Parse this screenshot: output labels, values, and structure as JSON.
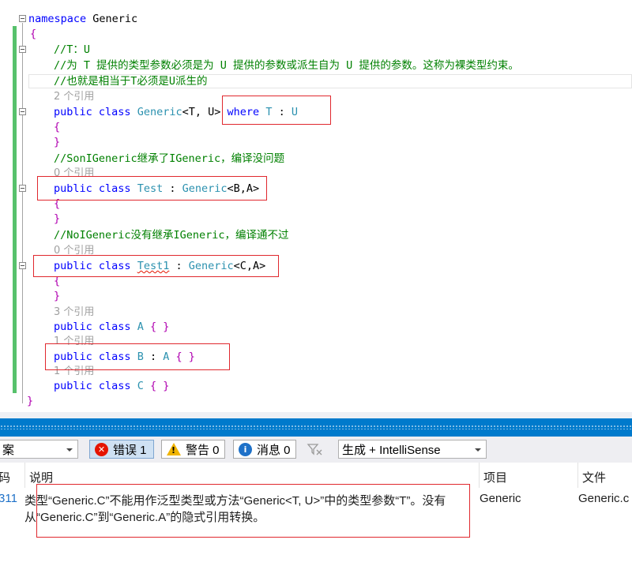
{
  "editor": {
    "line1": {
      "kw": "namespace",
      "name": " Generic"
    },
    "open_brace": "{",
    "close_brace": "}",
    "comment1": "//T：U",
    "comment2": "//为 T 提供的类型参数必须是为 U 提供的参数或派生自为 U 提供的参数。这称为裸类型约束。",
    "comment3": "//也就是相当于T必须是U派生的",
    "ref_generic": "2 个引用",
    "generic_decl": {
      "p1": "public",
      "p2": "class",
      "name": "Generic",
      "params": "<T, U>",
      "where": "where",
      "T": "T",
      "colon": " : ",
      "U": "U"
    },
    "comment4": "//SonIGeneric继承了IGeneric，编译没问题",
    "ref_test": "0 个引用",
    "test_decl": {
      "p1": "public",
      "p2": "class",
      "name": "Test",
      "colon": " : ",
      "base": "Generic",
      "args": "<B,A>"
    },
    "comment5": "//NoIGeneric没有继承IGeneric，编译通不过",
    "ref_test1": "0 个引用",
    "test1_decl": {
      "p1": "public",
      "p2": "class",
      "name": "Test1",
      "colon": " : ",
      "base": "Generic",
      "args": "<C,A>"
    },
    "ref_a": "3 个引用",
    "a_decl": {
      "p1": "public",
      "p2": "class",
      "name": "A",
      "body": "{ }"
    },
    "ref_b": "1 个引用",
    "b_decl": {
      "p1": "public",
      "p2": "class",
      "name": "B",
      "colon": " : ",
      "base": "A",
      "body": "{ }"
    },
    "ref_c": "1 个引用",
    "c_decl": {
      "p1": "public",
      "p2": "class",
      "name": "C",
      "body": "{ }"
    }
  },
  "error_list": {
    "scope_dropdown": "案",
    "errors_label": "错误 1",
    "warnings_label": "警告 0",
    "messages_label": "消息 0",
    "build_dropdown": "生成 + IntelliSense",
    "columns": {
      "code": "码",
      "description": "说明",
      "project": "项目",
      "file": "文件"
    },
    "rows": [
      {
        "code": "311",
        "description_line1": "类型“Generic.C”不能用作泛型类型或方法“Generic<T, U>”中的类型参数“T”。没有",
        "description_line2": "从“Generic.C”到“Generic.A”的隐式引用转换。",
        "project": "Generic",
        "file": "Generic.c"
      }
    ]
  },
  "colors": {
    "keyword": "#0000ff",
    "type": "#2b91af",
    "comment": "#008000",
    "accent": "#007acc",
    "highlight_box": "#e0282e"
  },
  "icons": [
    "collapse-icon",
    "error-icon",
    "warning-icon",
    "info-icon",
    "filter-icon",
    "chevron-down-icon"
  ]
}
